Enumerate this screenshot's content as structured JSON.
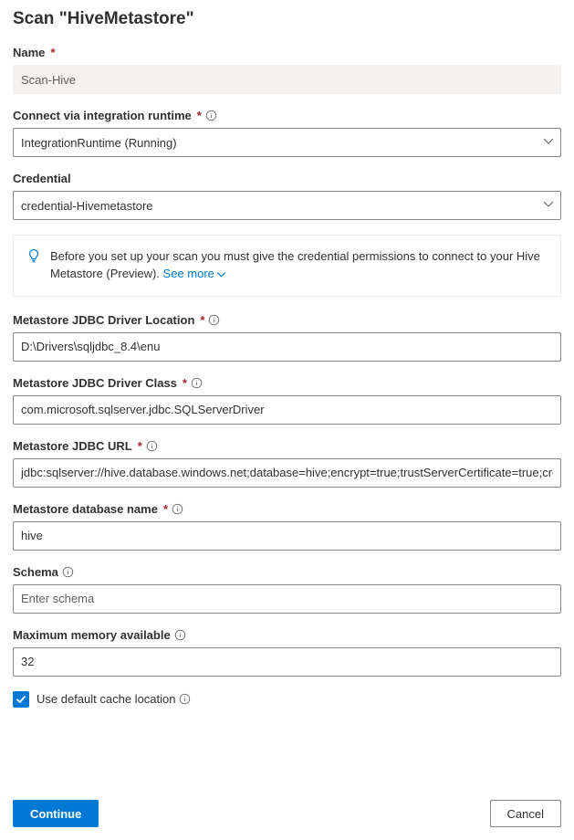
{
  "page_title": "Scan \"HiveMetastore\"",
  "fields": {
    "name": {
      "label": "Name",
      "value": "Scan-Hive"
    },
    "runtime": {
      "label": "Connect via integration runtime",
      "value": "IntegrationRuntime (Running)"
    },
    "credential": {
      "label": "Credential",
      "value": "credential-Hivemetastore"
    },
    "driver_location": {
      "label": "Metastore JDBC Driver Location",
      "value": "D:\\Drivers\\sqljdbc_8.4\\enu"
    },
    "driver_class": {
      "label": "Metastore JDBC Driver Class",
      "value": "com.microsoft.sqlserver.jdbc.SQLServerDriver"
    },
    "jdbc_url": {
      "label": "Metastore JDBC URL",
      "value": "jdbc:sqlserver://hive.database.windows.net;database=hive;encrypt=true;trustServerCertificate=true;create=fal"
    },
    "db_name": {
      "label": "Metastore database name",
      "value": "hive"
    },
    "schema": {
      "label": "Schema",
      "placeholder": "Enter schema"
    },
    "max_memory": {
      "label": "Maximum memory available",
      "value": "32"
    },
    "cache_checkbox_label": "Use default cache location"
  },
  "callout": {
    "text": "Before you set up your scan you must give the credential permissions to connect to your Hive Metastore (Preview). ",
    "see_more": "See more"
  },
  "buttons": {
    "continue": "Continue",
    "cancel": "Cancel"
  }
}
